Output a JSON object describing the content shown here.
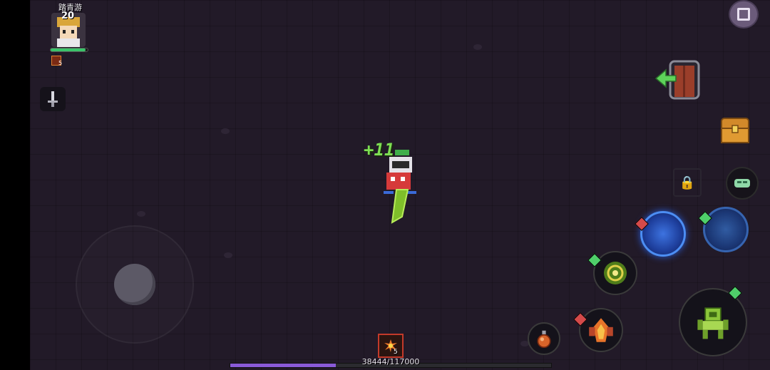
{
  "player": {
    "name": "踏青游",
    "level": "20",
    "hp_fraction": 0.95,
    "buff_count": "5"
  },
  "combat": {
    "floating_text": "+11"
  },
  "hud": {
    "item_count": "5",
    "xp_text": "38444/117000",
    "xp_current": 38444,
    "xp_max": 117000
  },
  "controls": {
    "pause_icon": "menu-grid-icon",
    "exit_icon": "exit-door-icon",
    "chest_icon": "treasure-chest-icon",
    "lock_icon": "lock-icon",
    "swap_icon": "swap-weapon-icon",
    "potion_icon": "potion-icon",
    "skill_main_icon": "mech-skill-icon",
    "skill_green_icon": "vortex-skill-icon",
    "skill_fire_icon": "fire-skill-icon"
  },
  "colors": {
    "background": "#221a28",
    "hp": "#3ac46a",
    "xp": "#8a5ad8",
    "float_text": "#7ddf52",
    "skill_blue": "#4c8ef4"
  }
}
